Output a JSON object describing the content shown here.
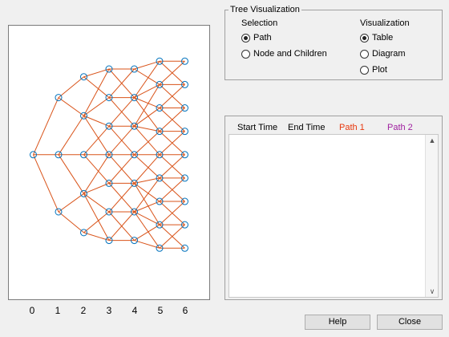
{
  "tree_panel": {
    "title": "Tree Visualization",
    "selection_label": "Selection",
    "visualization_label": "Visualization",
    "selection_options": [
      {
        "label": "Path",
        "checked": true
      },
      {
        "label": "Node and Children",
        "checked": false
      }
    ],
    "visualization_options": [
      {
        "label": "Table",
        "checked": true
      },
      {
        "label": "Diagram",
        "checked": false
      },
      {
        "label": "Plot",
        "checked": false
      }
    ]
  },
  "table": {
    "headers": [
      {
        "label": "Start Time",
        "color": "#000000"
      },
      {
        "label": "End Time",
        "color": "#000000"
      },
      {
        "label": "Path 1",
        "color": "#e8380d"
      },
      {
        "label": "Path 2",
        "color": "#a020a0"
      }
    ],
    "scroll_up_icon": "▲",
    "scroll_down_icon": "∨"
  },
  "buttons": {
    "help": "Help",
    "close": "Close"
  },
  "chart_data": {
    "type": "scatter",
    "xlim": [
      -1,
      7
    ],
    "ylim": [
      -5.6,
      5.0
    ],
    "xticks": [
      "0",
      "1",
      "2",
      "3",
      "4",
      "5",
      "6"
    ],
    "node_color": "#0072bd",
    "edge_color": "#d95319",
    "levels": [
      {
        "x": 0,
        "y": [
          0
        ]
      },
      {
        "x": 1,
        "y": [
          2.2,
          0,
          -2.2
        ]
      },
      {
        "x": 2,
        "y": [
          3,
          1.5,
          0,
          -1.5,
          -3
        ]
      },
      {
        "x": 3,
        "y": [
          3.3,
          2.2,
          1.1,
          0,
          -1.1,
          -2.2,
          -3.3
        ]
      },
      {
        "x": 4,
        "y": [
          3.3,
          2.2,
          1.1,
          0,
          -1.1,
          -2.2,
          -3.3
        ]
      },
      {
        "x": 5,
        "y": [
          3.6,
          2.7,
          1.8,
          0.9,
          0,
          -0.9,
          -1.8,
          -2.7,
          -3.6
        ]
      },
      {
        "x": 6,
        "y": [
          3.6,
          2.7,
          1.8,
          0.9,
          0,
          -0.9,
          -1.8,
          -2.7,
          -3.6
        ]
      }
    ]
  }
}
